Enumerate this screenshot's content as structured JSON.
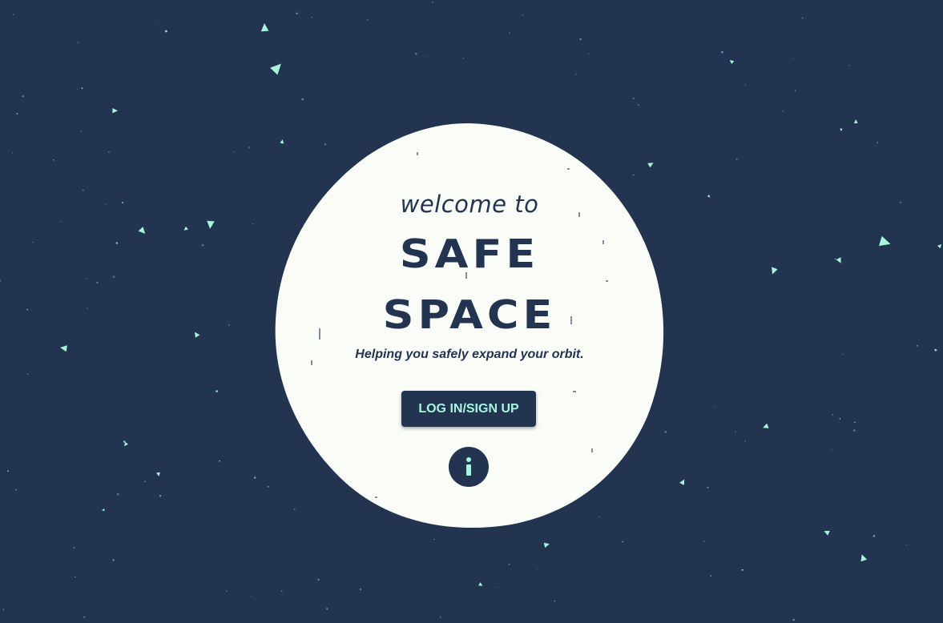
{
  "colors": {
    "background": "#22344f",
    "moon": "#fafcf8",
    "accent": "#a8f5dd",
    "text": "#22344f"
  },
  "hero": {
    "welcome": "welcome to",
    "title_line_1": "SAFE",
    "title_line_2": "SPACE",
    "tagline": "Helping you safely expand your orbit."
  },
  "actions": {
    "login_label": "LOG IN/SIGN UP",
    "info_icon": "info-icon"
  }
}
